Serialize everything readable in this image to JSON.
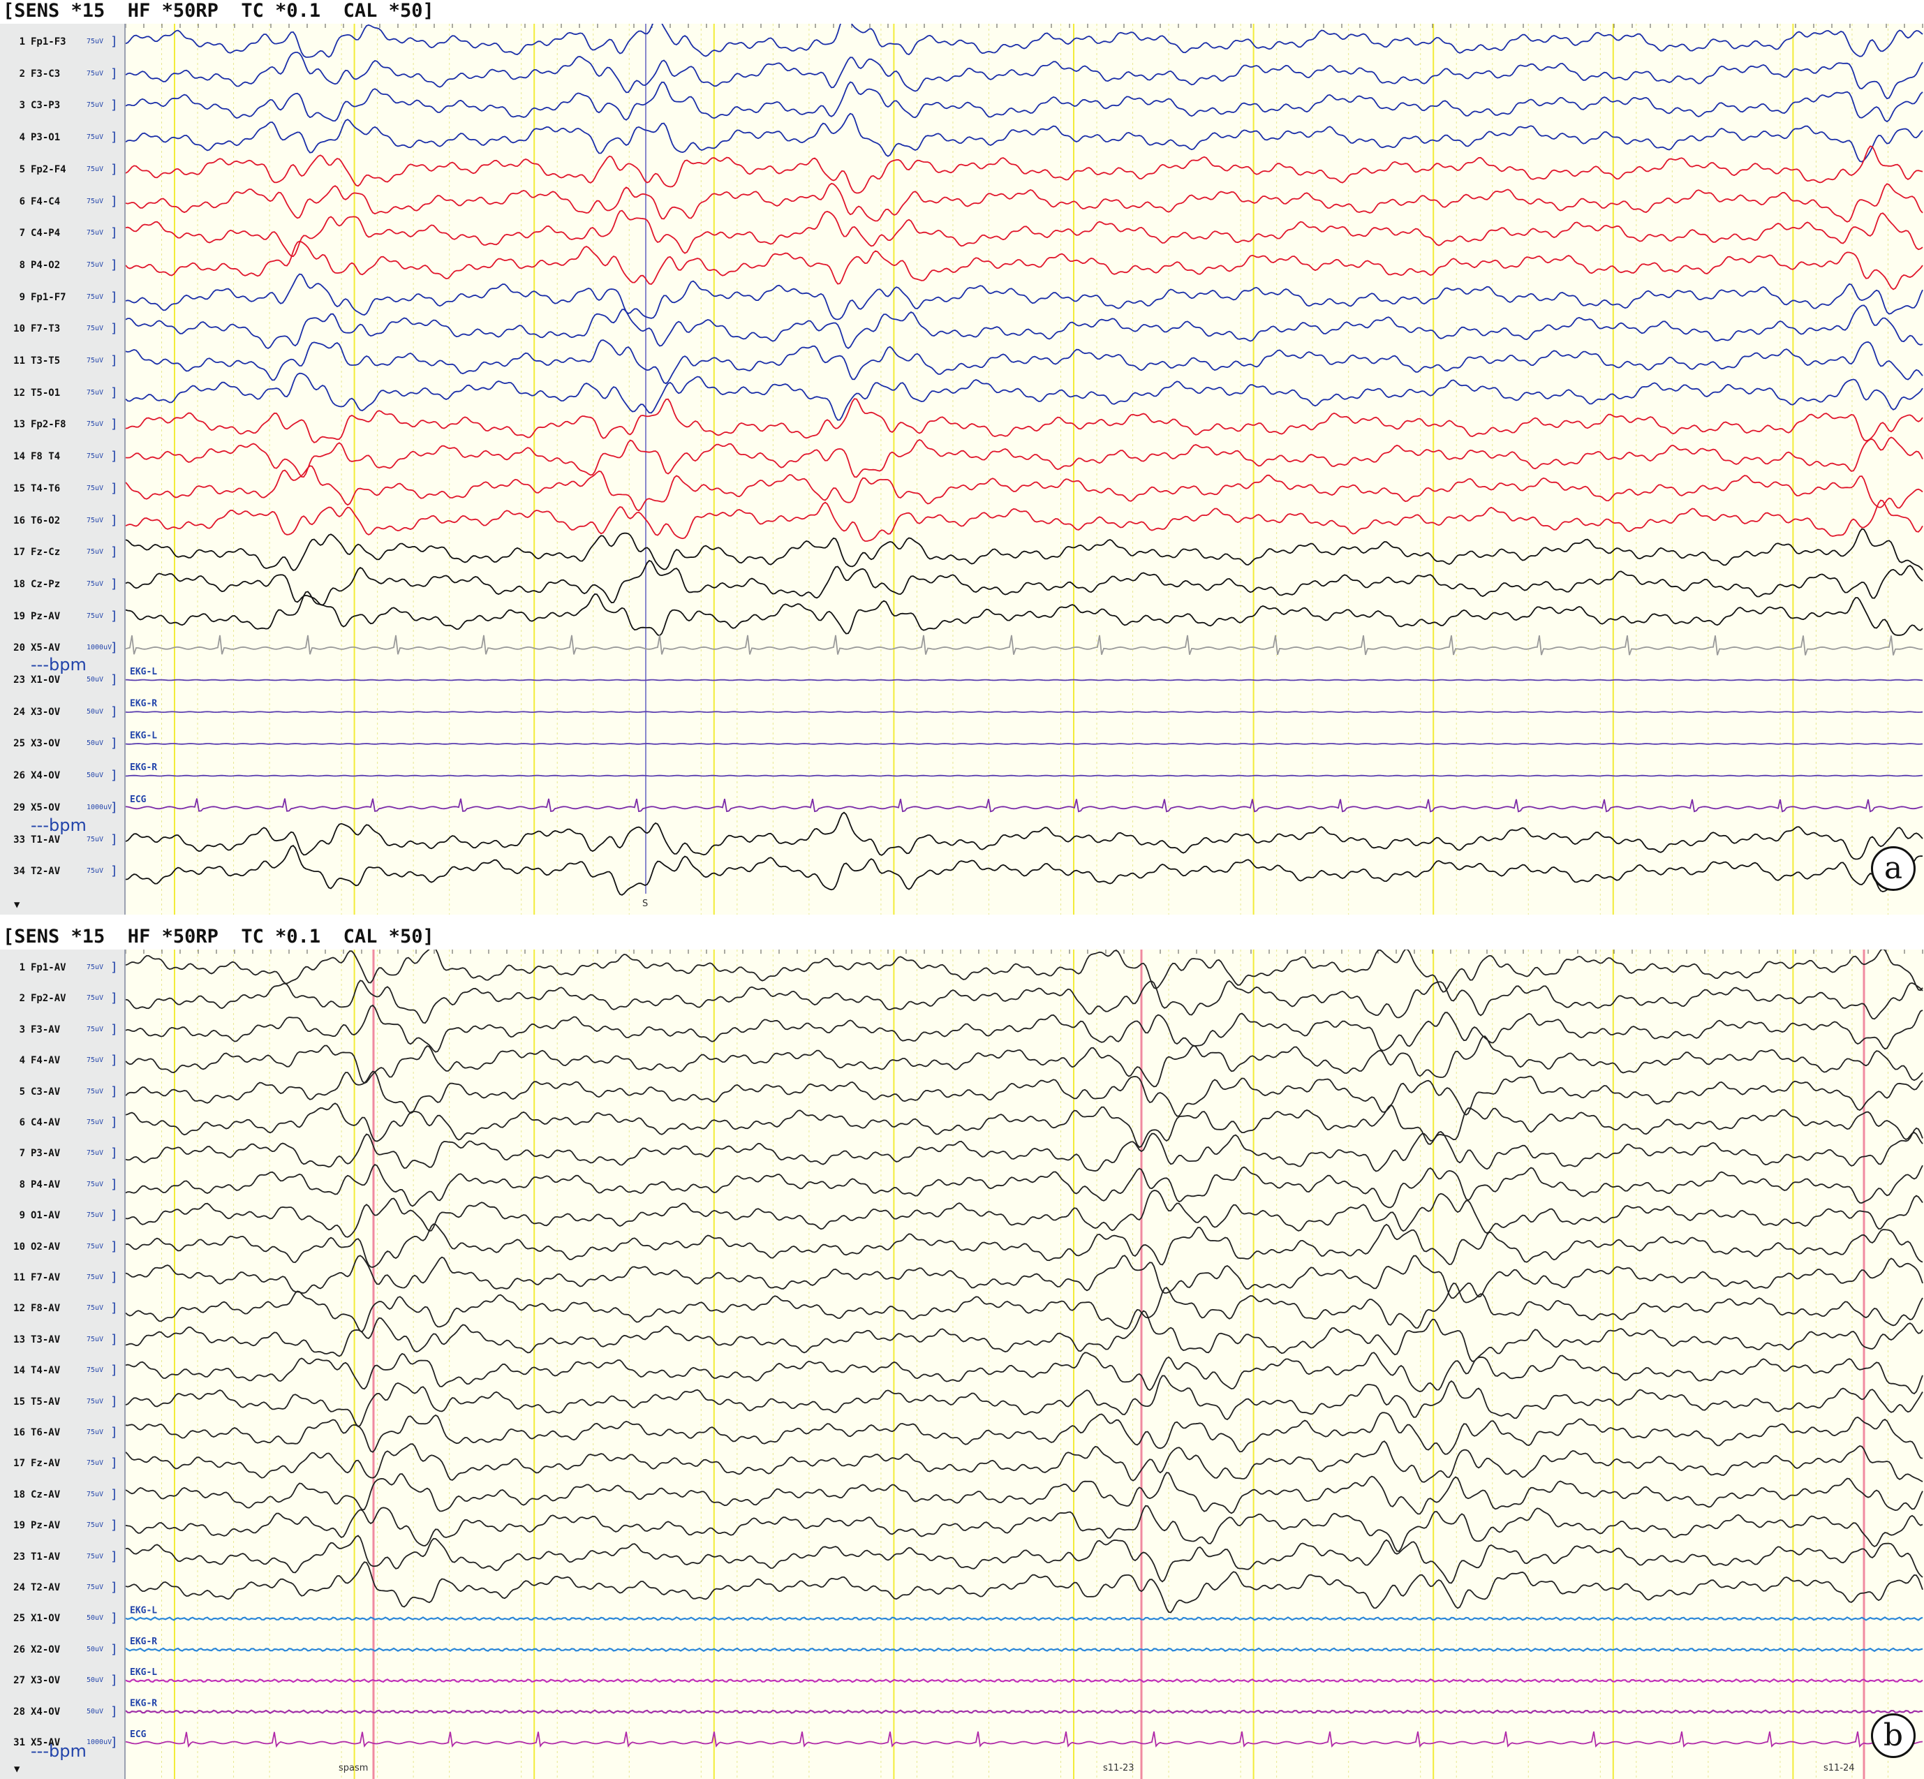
{
  "panels": [
    {
      "id": "a",
      "header": "[SENS *15  HF *50RP  TC *0.1  CAL *50]",
      "letter": "a",
      "channels": [
        {
          "num": "1",
          "name": "Fp1-F3",
          "sens": "75uV",
          "color": "#1a2ea8",
          "kind": "eeg"
        },
        {
          "num": "2",
          "name": "F3-C3",
          "sens": "75uV",
          "color": "#1a2ea8",
          "kind": "eeg"
        },
        {
          "num": "3",
          "name": "C3-P3",
          "sens": "75uV",
          "color": "#1a2ea8",
          "kind": "eeg"
        },
        {
          "num": "4",
          "name": "P3-O1",
          "sens": "75uV",
          "color": "#1a2ea8",
          "kind": "eeg"
        },
        {
          "num": "5",
          "name": "Fp2-F4",
          "sens": "75uV",
          "color": "#e0162b",
          "kind": "eeg"
        },
        {
          "num": "6",
          "name": "F4-C4",
          "sens": "75uV",
          "color": "#e0162b",
          "kind": "eeg"
        },
        {
          "num": "7",
          "name": "C4-P4",
          "sens": "75uV",
          "color": "#e0162b",
          "kind": "eeg"
        },
        {
          "num": "8",
          "name": "P4-O2",
          "sens": "75uV",
          "color": "#e0162b",
          "kind": "eeg"
        },
        {
          "num": "9",
          "name": "Fp1-F7",
          "sens": "75uV",
          "color": "#1a2ea8",
          "kind": "eeg"
        },
        {
          "num": "10",
          "name": "F7-T3",
          "sens": "75uV",
          "color": "#1a2ea8",
          "kind": "eeg"
        },
        {
          "num": "11",
          "name": "T3-T5",
          "sens": "75uV",
          "color": "#1a2ea8",
          "kind": "eeg"
        },
        {
          "num": "12",
          "name": "T5-O1",
          "sens": "75uV",
          "color": "#1a2ea8",
          "kind": "eeg"
        },
        {
          "num": "13",
          "name": "Fp2-F8",
          "sens": "75uV",
          "color": "#e0162b",
          "kind": "eeg"
        },
        {
          "num": "14",
          "name": "F8 T4",
          "sens": "75uV",
          "color": "#e0162b",
          "kind": "eeg"
        },
        {
          "num": "15",
          "name": "T4-T6",
          "sens": "75uV",
          "color": "#e0162b",
          "kind": "eeg"
        },
        {
          "num": "16",
          "name": "T6-O2",
          "sens": "75uV",
          "color": "#e0162b",
          "kind": "eeg"
        },
        {
          "num": "17",
          "name": "Fz-Cz",
          "sens": "75uV",
          "color": "#111111",
          "kind": "eeg"
        },
        {
          "num": "18",
          "name": "Cz-Pz",
          "sens": "75uV",
          "color": "#111111",
          "kind": "eeg"
        },
        {
          "num": "19",
          "name": "Pz-AV",
          "sens": "75uV",
          "color": "#111111",
          "kind": "eeg"
        },
        {
          "num": "20",
          "name": "X5-AV",
          "sens": "1000uV",
          "color": "#9a9a9a",
          "kind": "ecg"
        },
        {
          "num": "23",
          "name": "X1-OV",
          "sens": "50uV",
          "color": "#5b3fb0",
          "kind": "flat",
          "tag": "EKG-L"
        },
        {
          "num": "24",
          "name": "X3-OV",
          "sens": "50uV",
          "color": "#5b3fb0",
          "kind": "flat",
          "tag": "EKG-R"
        },
        {
          "num": "25",
          "name": "X3-OV",
          "sens": "50uV",
          "color": "#5b3fb0",
          "kind": "flat",
          "tag": "EKG-L"
        },
        {
          "num": "26",
          "name": "X4-OV",
          "sens": "50uV",
          "color": "#5b3fb0",
          "kind": "flat",
          "tag": "EKG-R"
        },
        {
          "num": "29",
          "name": "X5-OV",
          "sens": "1000uV",
          "color": "#7a2aa8",
          "kind": "ecg",
          "tag": "ECG"
        },
        {
          "num": "33",
          "name": "T1-AV",
          "sens": "75uV",
          "color": "#111111",
          "kind": "eeg"
        },
        {
          "num": "34",
          "name": "T2-AV",
          "sens": "75uV",
          "color": "#111111",
          "kind": "eeg"
        }
      ],
      "bpm_label": "---bpm",
      "bpm_label_2": "---bpm",
      "marker_text": "S"
    },
    {
      "id": "b",
      "header": "[SENS *15  HF *50RP  TC *0.1  CAL *50]",
      "letter": "b",
      "channels": [
        {
          "num": "1",
          "name": "Fp1-AV",
          "sens": "75uV",
          "color": "#222222",
          "kind": "eeg"
        },
        {
          "num": "2",
          "name": "Fp2-AV",
          "sens": "75uV",
          "color": "#222222",
          "kind": "eeg"
        },
        {
          "num": "3",
          "name": "F3-AV",
          "sens": "75uV",
          "color": "#222222",
          "kind": "eeg"
        },
        {
          "num": "4",
          "name": "F4-AV",
          "sens": "75uV",
          "color": "#222222",
          "kind": "eeg"
        },
        {
          "num": "5",
          "name": "C3-AV",
          "sens": "75uV",
          "color": "#222222",
          "kind": "eeg"
        },
        {
          "num": "6",
          "name": "C4-AV",
          "sens": "75uV",
          "color": "#222222",
          "kind": "eeg"
        },
        {
          "num": "7",
          "name": "P3-AV",
          "sens": "75uV",
          "color": "#222222",
          "kind": "eeg"
        },
        {
          "num": "8",
          "name": "P4-AV",
          "sens": "75uV",
          "color": "#222222",
          "kind": "eeg"
        },
        {
          "num": "9",
          "name": "O1-AV",
          "sens": "75uV",
          "color": "#222222",
          "kind": "eeg"
        },
        {
          "num": "10",
          "name": "O2-AV",
          "sens": "75uV",
          "color": "#222222",
          "kind": "eeg"
        },
        {
          "num": "11",
          "name": "F7-AV",
          "sens": "75uV",
          "color": "#222222",
          "kind": "eeg"
        },
        {
          "num": "12",
          "name": "F8-AV",
          "sens": "75uV",
          "color": "#222222",
          "kind": "eeg"
        },
        {
          "num": "13",
          "name": "T3-AV",
          "sens": "75uV",
          "color": "#222222",
          "kind": "eeg"
        },
        {
          "num": "14",
          "name": "T4-AV",
          "sens": "75uV",
          "color": "#222222",
          "kind": "eeg"
        },
        {
          "num": "15",
          "name": "T5-AV",
          "sens": "75uV",
          "color": "#222222",
          "kind": "eeg"
        },
        {
          "num": "16",
          "name": "T6-AV",
          "sens": "75uV",
          "color": "#222222",
          "kind": "eeg"
        },
        {
          "num": "17",
          "name": "Fz-AV",
          "sens": "75uV",
          "color": "#222222",
          "kind": "eeg"
        },
        {
          "num": "18",
          "name": "Cz-AV",
          "sens": "75uV",
          "color": "#222222",
          "kind": "eeg"
        },
        {
          "num": "19",
          "name": "Pz-AV",
          "sens": "75uV",
          "color": "#222222",
          "kind": "eeg"
        },
        {
          "num": "23",
          "name": "T1-AV",
          "sens": "75uV",
          "color": "#222222",
          "kind": "eeg"
        },
        {
          "num": "24",
          "name": "T2-AV",
          "sens": "75uV",
          "color": "#222222",
          "kind": "eeg"
        },
        {
          "num": "25",
          "name": "X1-OV",
          "sens": "50uV",
          "color": "#2a86d8",
          "kind": "emg",
          "tag": "EKG-L"
        },
        {
          "num": "26",
          "name": "X2-OV",
          "sens": "50uV",
          "color": "#2a86d8",
          "kind": "emg",
          "tag": "EKG-R"
        },
        {
          "num": "27",
          "name": "X3-OV",
          "sens": "50uV",
          "color": "#c02fb8",
          "kind": "emg",
          "tag": "EKG-L"
        },
        {
          "num": "28",
          "name": "X4-OV",
          "sens": "50uV",
          "color": "#a02fa8",
          "kind": "emg",
          "tag": "EKG-R"
        },
        {
          "num": "31",
          "name": "X5-AV",
          "sens": "1000uV",
          "color": "#b02aa8",
          "kind": "ecg",
          "tag": "ECG"
        }
      ],
      "bpm_label": "---bpm",
      "markers": [
        "spasm",
        "s11-23",
        "s11-24"
      ]
    }
  ],
  "footer_mark": "▼"
}
